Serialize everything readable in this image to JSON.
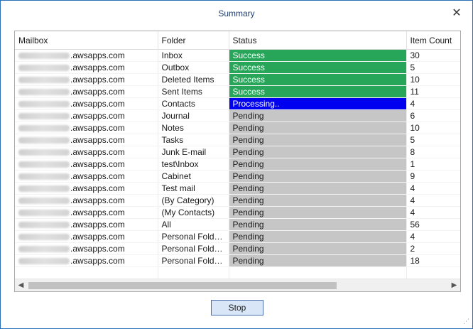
{
  "window": {
    "title": "Summary",
    "close_glyph": "✕"
  },
  "table": {
    "columns": [
      {
        "label": "Mailbox"
      },
      {
        "label": "Folder"
      },
      {
        "label": "Status"
      },
      {
        "label": "Item Count"
      }
    ],
    "rows": [
      {
        "mailbox": ".awsapps.com",
        "folder": "Inbox",
        "status": "Success",
        "count": "30"
      },
      {
        "mailbox": ".awsapps.com",
        "folder": "Outbox",
        "status": "Success",
        "count": "5"
      },
      {
        "mailbox": ".awsapps.com",
        "folder": "Deleted Items",
        "status": "Success",
        "count": "10"
      },
      {
        "mailbox": ".awsapps.com",
        "folder": "Sent Items",
        "status": "Success",
        "count": "11"
      },
      {
        "mailbox": ".awsapps.com",
        "folder": "Contacts",
        "status": "Processing..",
        "count": "4"
      },
      {
        "mailbox": ".awsapps.com",
        "folder": "Journal",
        "status": "Pending",
        "count": "6"
      },
      {
        "mailbox": ".awsapps.com",
        "folder": "Notes",
        "status": "Pending",
        "count": "10"
      },
      {
        "mailbox": ".awsapps.com",
        "folder": "Tasks",
        "status": "Pending",
        "count": "5"
      },
      {
        "mailbox": ".awsapps.com",
        "folder": "Junk E-mail",
        "status": "Pending",
        "count": "8"
      },
      {
        "mailbox": ".awsapps.com",
        "folder": "test\\Inbox",
        "status": "Pending",
        "count": "1"
      },
      {
        "mailbox": ".awsapps.com",
        "folder": "Cabinet",
        "status": "Pending",
        "count": "9"
      },
      {
        "mailbox": ".awsapps.com",
        "folder": "Test mail",
        "status": "Pending",
        "count": "4"
      },
      {
        "mailbox": ".awsapps.com",
        "folder": "(By Category)",
        "status": "Pending",
        "count": "4"
      },
      {
        "mailbox": ".awsapps.com",
        "folder": "(My Contacts)",
        "status": "Pending",
        "count": "4"
      },
      {
        "mailbox": ".awsapps.com",
        "folder": "All",
        "status": "Pending",
        "count": "56"
      },
      {
        "mailbox": ".awsapps.com",
        "folder": "Personal Folder...",
        "status": "Pending",
        "count": "4"
      },
      {
        "mailbox": ".awsapps.com",
        "folder": "Personal Folder...",
        "status": "Pending",
        "count": "2"
      },
      {
        "mailbox": ".awsapps.com",
        "folder": "Personal Folder...",
        "status": "Pending",
        "count": "18"
      }
    ],
    "status_colors": {
      "Success": "#27a65a",
      "Processing..": "#0000f0",
      "Pending": "#c6c6c6"
    }
  },
  "scrollbar": {
    "left_icon": "chevron-left-icon",
    "right_icon": "chevron-right-icon"
  },
  "buttons": {
    "stop_label": "Stop"
  }
}
